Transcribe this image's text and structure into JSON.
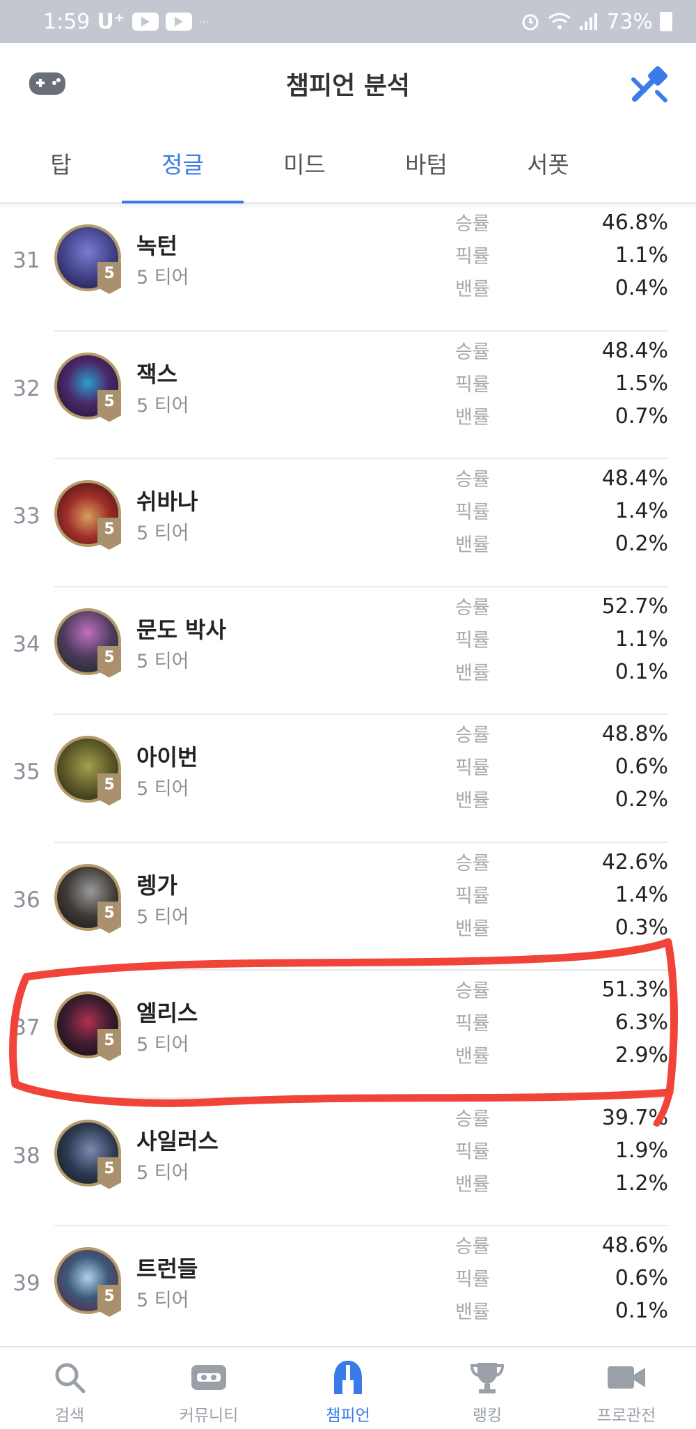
{
  "status_bar": {
    "time": "1:59",
    "carrier": "U⁺",
    "dots": "···",
    "battery": "73%"
  },
  "header": {
    "title": "챔피언 분석",
    "left_icon": "gamepad-icon",
    "right_icon": "patch-hammer-icon"
  },
  "tabs": [
    {
      "label": "탑",
      "active": false
    },
    {
      "label": "정글",
      "active": true
    },
    {
      "label": "미드",
      "active": false
    },
    {
      "label": "바텀",
      "active": false
    },
    {
      "label": "서폿",
      "active": false
    }
  ],
  "stat_labels": {
    "win": "승률",
    "pick": "픽률",
    "ban": "밴률"
  },
  "champions": [
    {
      "rank": "31",
      "name": "녹턴",
      "tier": "5 티어",
      "badge": "5",
      "win": "46.8%",
      "pick": "1.1%",
      "ban": "0.4%",
      "color": "#3f3f86"
    },
    {
      "rank": "32",
      "name": "잭스",
      "tier": "5 티어",
      "badge": "5",
      "win": "48.4%",
      "pick": "1.5%",
      "ban": "0.7%",
      "color": "#4b2a6b"
    },
    {
      "rank": "33",
      "name": "쉬바나",
      "tier": "5 티어",
      "badge": "5",
      "win": "48.4%",
      "pick": "1.4%",
      "ban": "0.2%",
      "color": "#7a1f22"
    },
    {
      "rank": "34",
      "name": "문도 박사",
      "tier": "5 티어",
      "badge": "5",
      "win": "52.7%",
      "pick": "1.1%",
      "ban": "0.1%",
      "color": "#4a3a5a"
    },
    {
      "rank": "35",
      "name": "아이번",
      "tier": "5 티어",
      "badge": "5",
      "win": "48.8%",
      "pick": "0.6%",
      "ban": "0.2%",
      "color": "#5d5a2a"
    },
    {
      "rank": "36",
      "name": "렝가",
      "tier": "5 티어",
      "badge": "5",
      "win": "42.6%",
      "pick": "1.4%",
      "ban": "0.3%",
      "color": "#3e3a36"
    },
    {
      "rank": "37",
      "name": "엘리스",
      "tier": "5 티어",
      "badge": "5",
      "win": "51.3%",
      "pick": "6.3%",
      "ban": "2.9%",
      "color": "#3a1d2e"
    },
    {
      "rank": "38",
      "name": "사일러스",
      "tier": "5 티어",
      "badge": "5",
      "win": "39.7%",
      "pick": "1.9%",
      "ban": "1.2%",
      "color": "#2e3a52"
    },
    {
      "rank": "39",
      "name": "트런들",
      "tier": "5 티어",
      "badge": "5",
      "win": "48.6%",
      "pick": "0.6%",
      "ban": "0.1%",
      "color": "#3c5a7a"
    }
  ],
  "bottom_nav": [
    {
      "label": "검색",
      "icon": "search-icon",
      "active": false
    },
    {
      "label": "커뮤니티",
      "icon": "community-icon",
      "active": false
    },
    {
      "label": "챔피언",
      "icon": "champion-helmet-icon",
      "active": true
    },
    {
      "label": "랭킹",
      "icon": "trophy-icon",
      "active": false
    },
    {
      "label": "프로관전",
      "icon": "video-camera-icon",
      "active": false
    }
  ],
  "colors": {
    "accent": "#3a7bea",
    "annotation": "#f04438",
    "status_bar": "#c2c7d0"
  }
}
